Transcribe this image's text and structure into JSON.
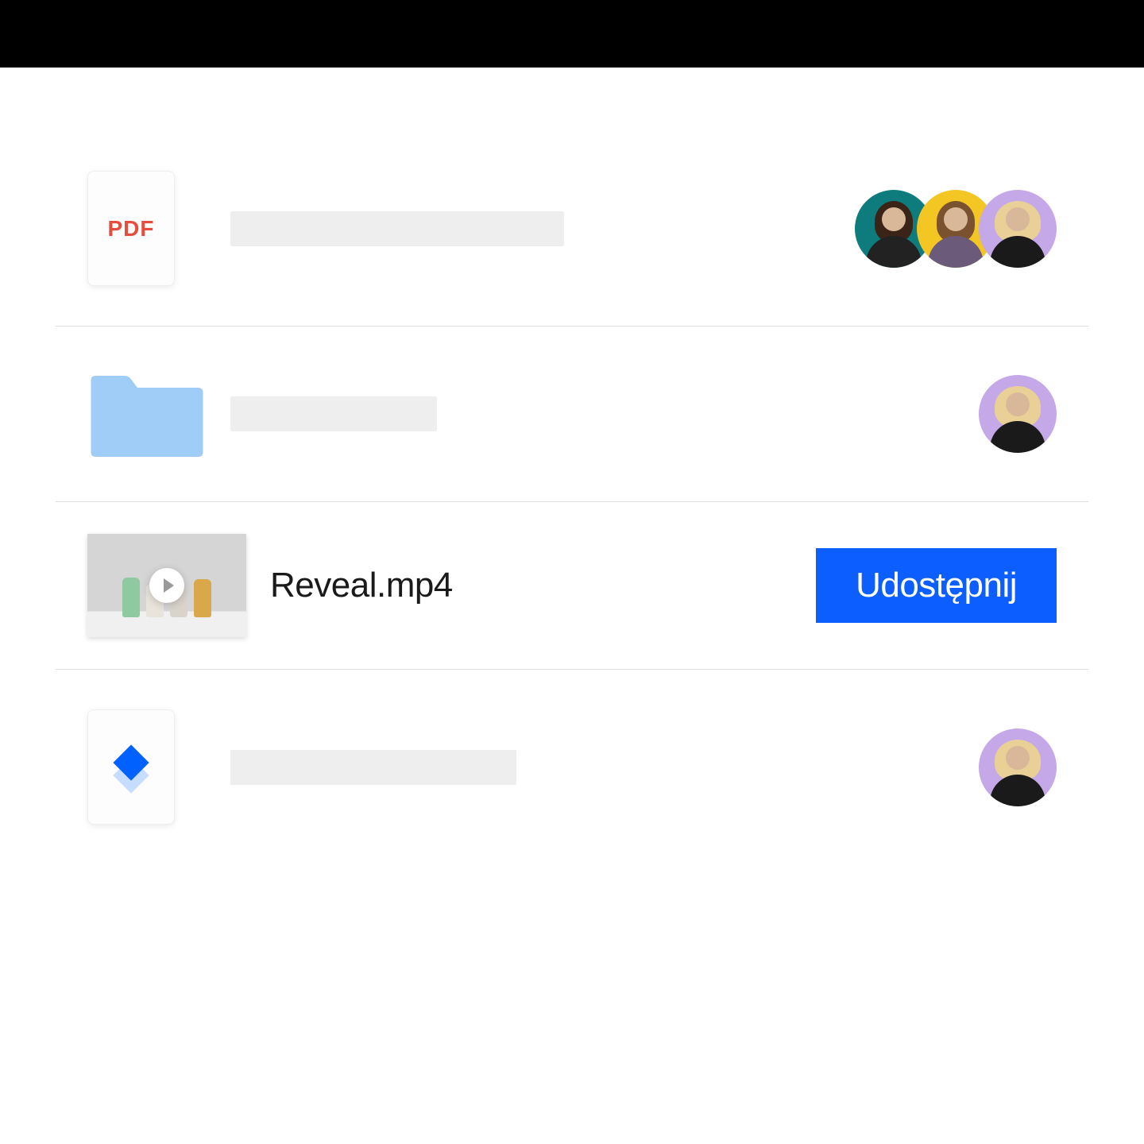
{
  "colors": {
    "share_button_bg": "#0d5eff",
    "pdf_label_color": "#e74c3c",
    "folder_color": "#9fcdf8",
    "avatar_teal": "#0e7c7c",
    "avatar_yellow": "#f4c623",
    "avatar_lilac": "#c5a8e8"
  },
  "rows": [
    {
      "type": "pdf",
      "icon_label": "PDF",
      "name": null,
      "avatars": [
        "teal",
        "yellow",
        "lilac"
      ]
    },
    {
      "type": "folder",
      "name": null,
      "avatars": [
        "lilac"
      ]
    },
    {
      "type": "video",
      "name": "Reveal.mp4",
      "action_label": "Udostępnij"
    },
    {
      "type": "dropbox-file",
      "name": null,
      "avatars": [
        "lilac"
      ]
    }
  ]
}
